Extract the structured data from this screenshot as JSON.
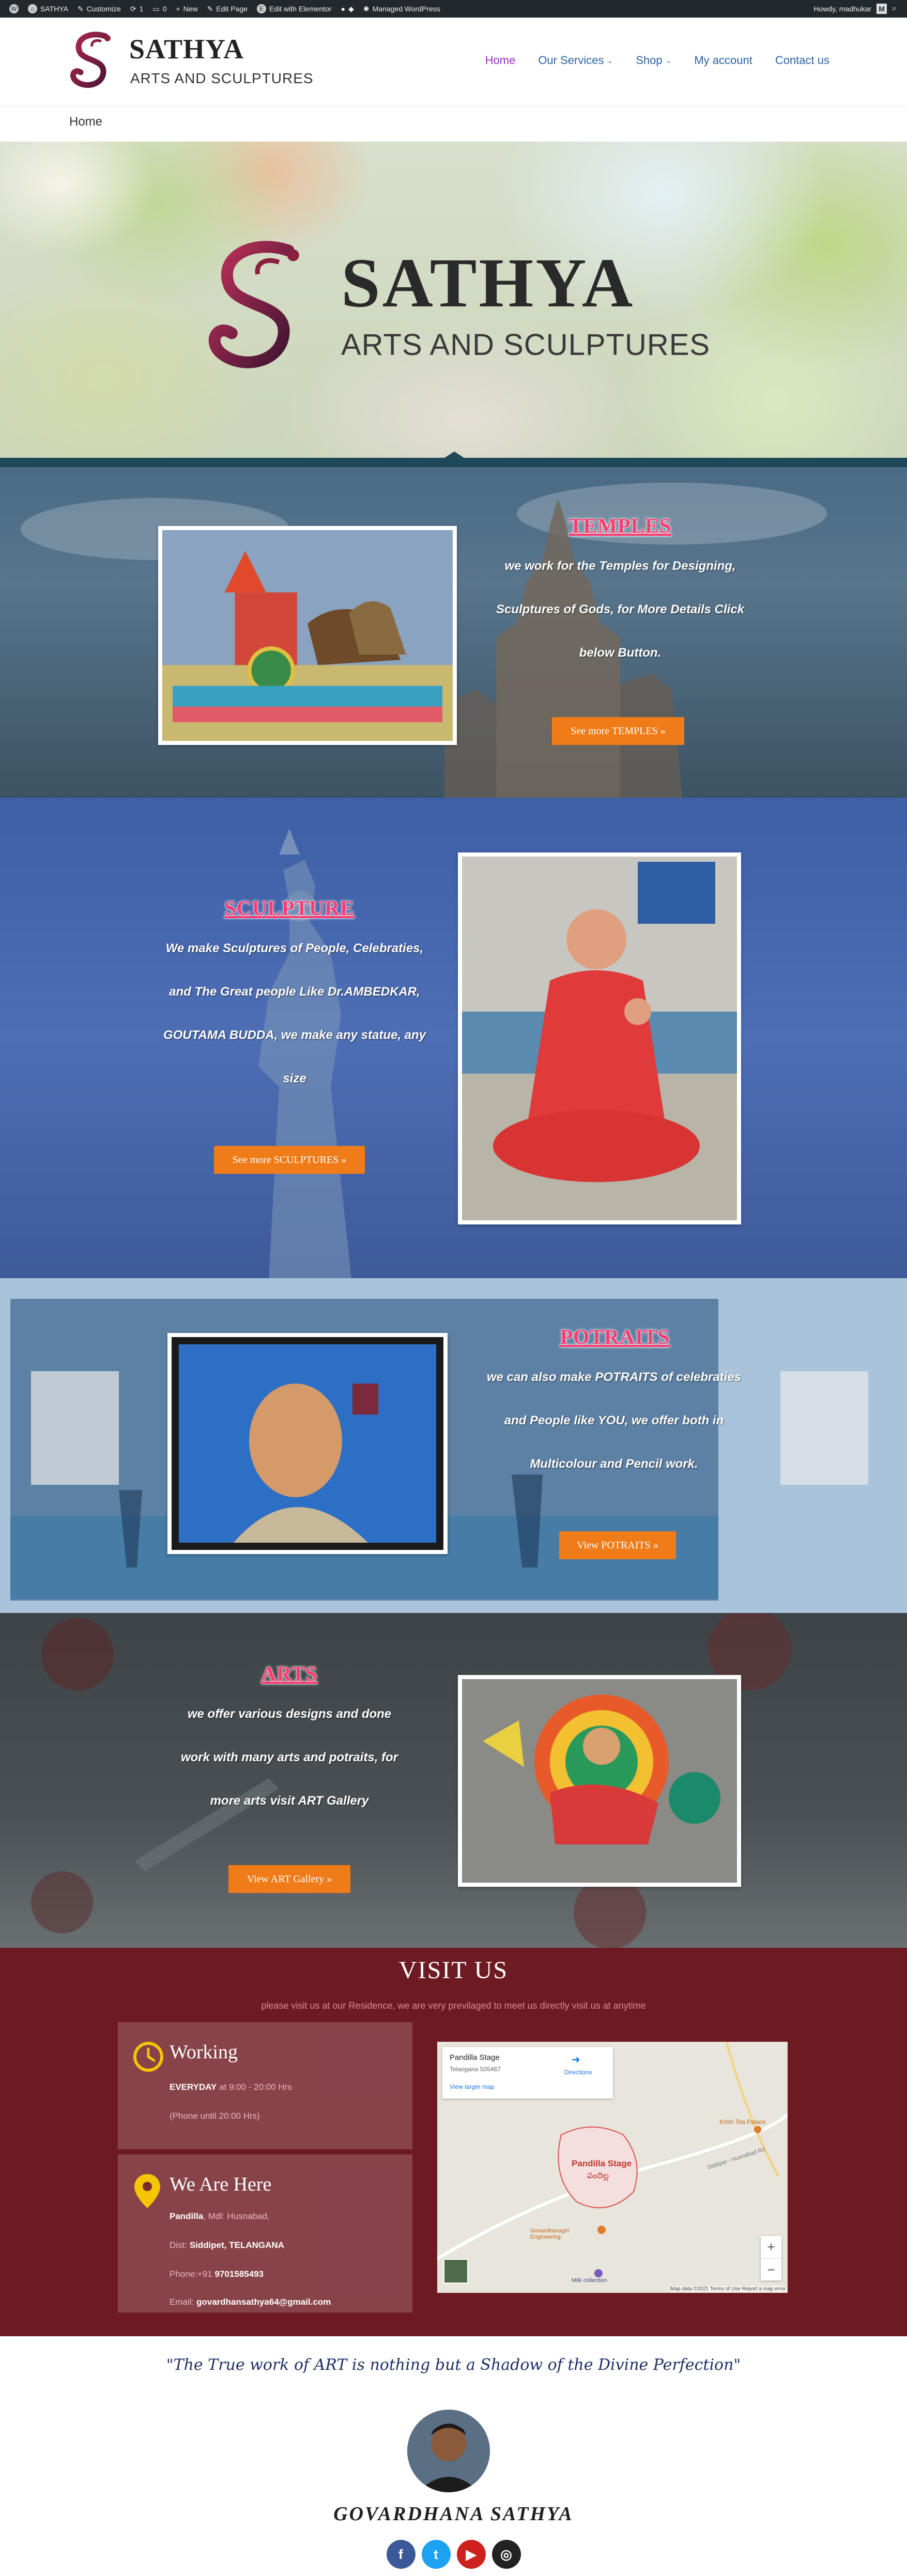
{
  "admin_bar": {
    "site": "SATHYA",
    "customize": "Customize",
    "updates": "1",
    "comments": "0",
    "new": "New",
    "edit_page": "Edit Page",
    "elementor": "Edit with Elementor",
    "managed": "Managed WordPress",
    "greeting": "Howdy, madhukar"
  },
  "header": {
    "brand_title": "SATHYA",
    "brand_sub": "ARTS AND SCULPTURES",
    "nav": [
      "Home",
      "Our Services",
      "Shop",
      "My account",
      "Contact us"
    ]
  },
  "breadcrumb": "Home",
  "hero": {
    "title": "SATHYA",
    "sub": "ARTS AND SCULPTURES"
  },
  "temples": {
    "title": "TEMPLES",
    "lines": [
      "we work for the Temples for Designing,",
      "Sculptures of Gods, for More Details Click",
      "below Button."
    ],
    "button": "See more TEMPLES »"
  },
  "sculpture": {
    "title": "SCULPTURE",
    "lines": [
      "We make Sculptures of People, Celebraties,",
      "and The Great people Like Dr.AMBEDKAR,",
      "GOUTAMA BUDDA, we make any statue, any",
      "size"
    ],
    "button": "See more SCULPTURES »"
  },
  "potraits": {
    "title": "POTRAITS",
    "lines": [
      "we can also make POTRAITS of celebraties",
      "and People like YOU, we offer both in",
      "Multicolour and Pencil work."
    ],
    "button": "View POTRAITS »"
  },
  "arts": {
    "title": "ARTS",
    "lines": [
      "we  offer various designs and  done",
      "work with many arts and potraits, for",
      "more arts visit ART Gallery"
    ],
    "button": "View ART Gallery »"
  },
  "visit": {
    "title": "VISIT US",
    "sub": "please visit us at our Residence, we are very previlaged to meet us directly visit us at anytime",
    "working": {
      "heading": "Working",
      "days": "EVERYDAY",
      "hours": " at 9:00 - 20:00 Hrs",
      "note": "(Phone until 20:00 Hrs)"
    },
    "here": {
      "heading": "We Are Here",
      "place": "Pandilla",
      "place_rest": ", Mdl: Husnabad,",
      "dist_label": "Dist:",
      "dist": " Siddipet, TELANGANA",
      "phone_label": "Phone:+91 ",
      "phone": "9701585493",
      "email_label": "Email: ",
      "email": "govardhansathya64@gmail.com"
    },
    "map": {
      "place": "Pandilla Stage",
      "region": "Telangana 505467",
      "directions": "Directions",
      "larger": "View larger map",
      "label_main": "Pandilla Stage",
      "label_local": "పందిల్ల",
      "poi1": "Krish Tea Palace",
      "poi2": "Govardhanagiri Engineering",
      "poi3": "Milk collection",
      "road": "Siddipet - Husnabad Rd",
      "attrib": "Map data ©2021   Terms of Use   Report a map error",
      "zoom_in": "+",
      "zoom_out": "−"
    }
  },
  "quote": "\"The True work of ART is nothing but a Shadow of the Divine Perfection\"",
  "person": "GOVARDHANA SATHYA",
  "colors": {
    "accent_orange": "#ef7c18",
    "title_pink": "#ff3a6e",
    "visit_bg": "#6e1a22",
    "nav_link": "#2d62a3",
    "nav_active": "#9b2fc4"
  }
}
